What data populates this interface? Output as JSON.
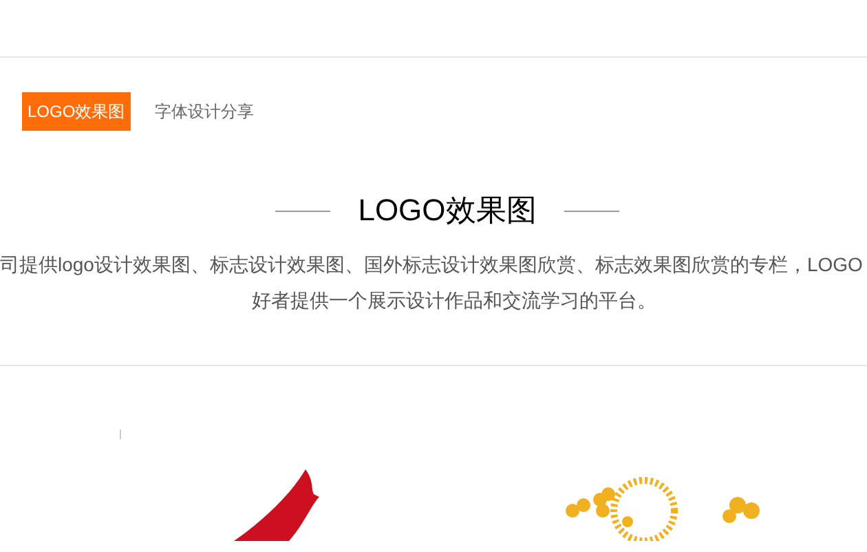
{
  "tabs": [
    {
      "label": "LOGO效果图",
      "selected": true
    },
    {
      "label": "字体设计分享",
      "selected": false
    }
  ],
  "section": {
    "title": "LOGO效果图",
    "description_lines": [
      "司提供logo设计效果图、标志设计效果图、国外标志设计效果图欣赏、标志效果图欣赏的专栏，LOGO",
      "好者提供一个展示设计作品和交流学习的平台。"
    ]
  }
}
